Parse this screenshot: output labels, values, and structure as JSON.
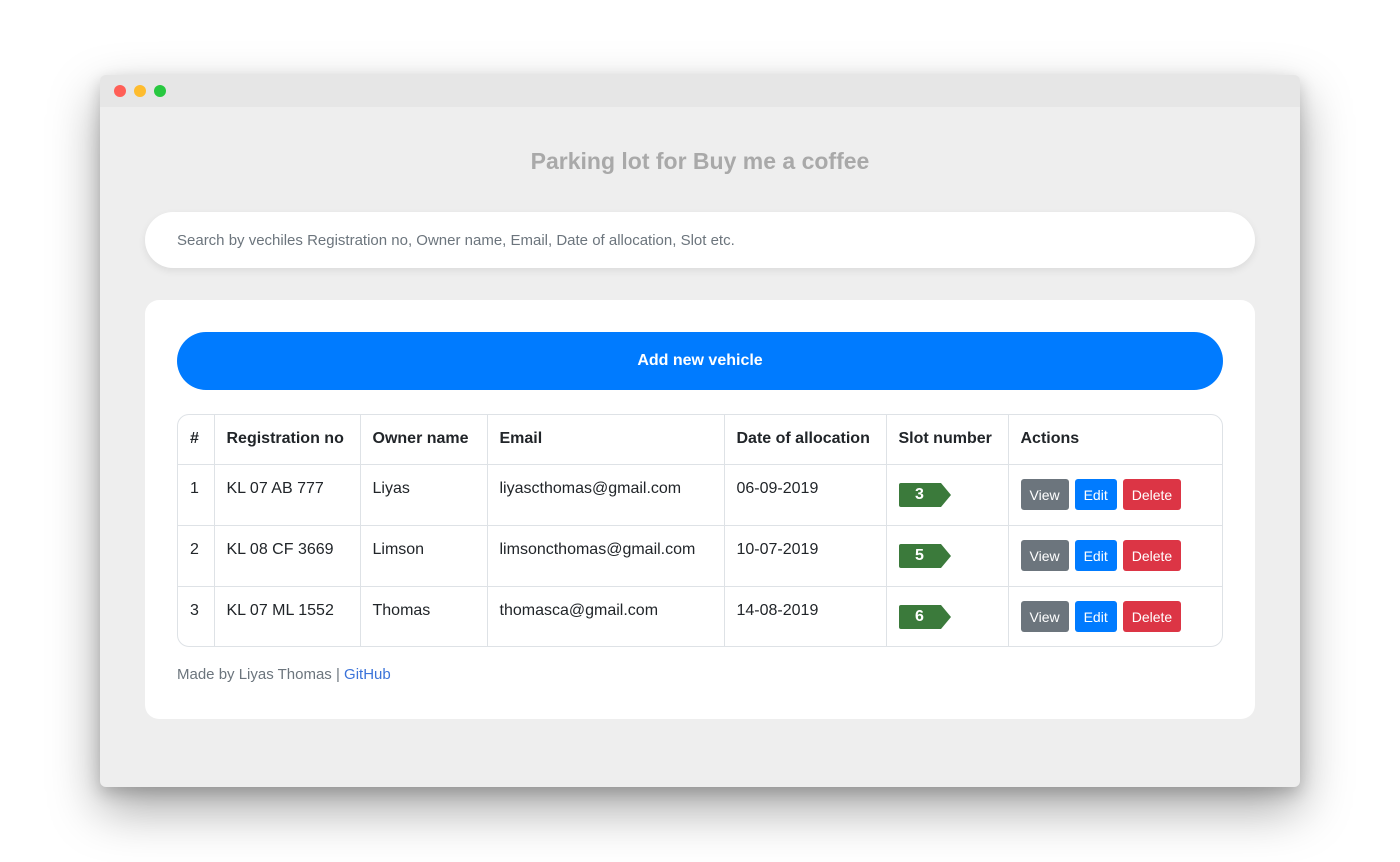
{
  "app": {
    "title": "Parking lot for Buy me a coffee"
  },
  "search": {
    "placeholder": "Search by vechiles Registration no, Owner name, Email, Date of allocation, Slot etc.",
    "value": ""
  },
  "toolbar": {
    "add_label": "Add new vehicle"
  },
  "table": {
    "headers": [
      "#",
      "Registration no",
      "Owner name",
      "Email",
      "Date of allocation",
      "Slot number",
      "Actions"
    ],
    "rows": [
      {
        "index": "1",
        "reg": "KL 07 AB 777",
        "owner": "Liyas",
        "email": "liyascthomas@gmail.com",
        "date": "06-09-2019",
        "slot": "3"
      },
      {
        "index": "2",
        "reg": "KL 08 CF 3669",
        "owner": "Limson",
        "email": "limsoncthomas@gmail.com",
        "date": "10-07-2019",
        "slot": "5"
      },
      {
        "index": "3",
        "reg": "KL 07 ML 1552",
        "owner": "Thomas",
        "email": "thomasca@gmail.com",
        "date": "14-08-2019",
        "slot": "6"
      }
    ],
    "actions": {
      "view": "View",
      "edit": "Edit",
      "delete": "Delete"
    }
  },
  "footer": {
    "made_by": "Made by Liyas Thomas |",
    "link_label": "GitHub"
  },
  "colors": {
    "primary": "#007bff",
    "secondary": "#6c757d",
    "danger": "#dc3545",
    "slot_badge": "#3b7a3b"
  }
}
